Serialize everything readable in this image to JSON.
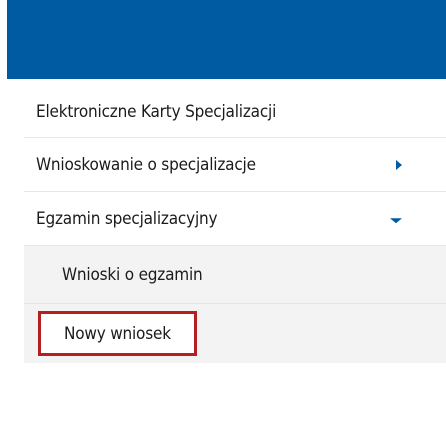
{
  "menu": {
    "items": [
      {
        "label": "Elektroniczne Karty Specjalizacji"
      },
      {
        "label": "Wnioskowanie o specjalizacje",
        "icon": "chevron-right-icon"
      },
      {
        "label": "Egzamin specjalizacyjny",
        "icon": "chevron-down-icon",
        "expanded": true,
        "children": [
          {
            "label": "Wnioski o egzamin"
          },
          {
            "label": "Nowy wniosek",
            "highlighted": true
          }
        ]
      }
    ]
  },
  "colors": {
    "primary": "#005ba3",
    "highlight": "#b51f1f",
    "submenu_background": "#f3f3f3"
  }
}
